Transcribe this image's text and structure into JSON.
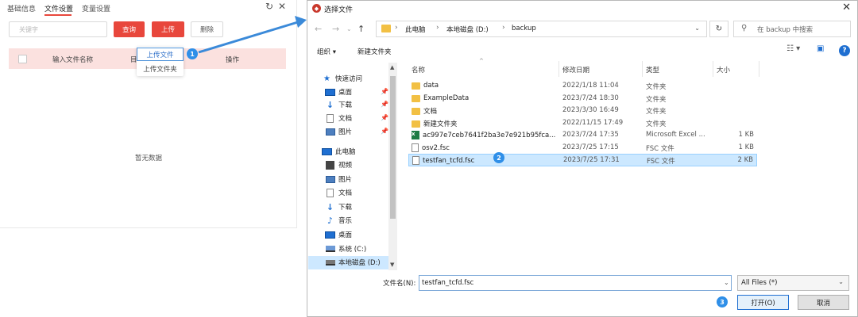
{
  "left_panel": {
    "tabs": [
      "基础信息",
      "文件设置",
      "变量设置"
    ],
    "active_tab": 1,
    "search_placeholder": "关键字",
    "buttons": {
      "query": "查询",
      "upload": "上传",
      "delete": "删除"
    },
    "table_headers": {
      "name": "输入文件名称",
      "col2": "目",
      "ops": "操作"
    },
    "empty_text": "暂无数据",
    "upload_menu": [
      "上传文件",
      "上传文件夹"
    ],
    "accent_color": "#e8473c"
  },
  "badges": [
    "1",
    "2",
    "3"
  ],
  "dialog": {
    "title": "选择文件",
    "address": [
      "此电脑",
      "本地磁盘 (D:)",
      "backup"
    ],
    "search_placeholder": "在 backup 中搜索",
    "toolbar": {
      "organize": "组织 ▾",
      "new_folder": "新建文件夹"
    },
    "nav": [
      {
        "label": "快速访问",
        "icon": "star-icon",
        "level": 1
      },
      {
        "label": "桌面",
        "icon": "desktop-icon",
        "level": 2,
        "pinned": true
      },
      {
        "label": "下载",
        "icon": "download-icon",
        "level": 2,
        "pinned": true
      },
      {
        "label": "文档",
        "icon": "document-icon",
        "level": 2,
        "pinned": true
      },
      {
        "label": "图片",
        "icon": "picture-icon",
        "level": 2,
        "pinned": true
      },
      {
        "label": "此电脑",
        "icon": "computer-icon",
        "level": 1
      },
      {
        "label": "视频",
        "icon": "video-icon",
        "level": 2
      },
      {
        "label": "图片",
        "icon": "picture-icon",
        "level": 2
      },
      {
        "label": "文档",
        "icon": "document-icon",
        "level": 2
      },
      {
        "label": "下载",
        "icon": "download-icon",
        "level": 2
      },
      {
        "label": "音乐",
        "icon": "music-icon",
        "level": 2
      },
      {
        "label": "桌面",
        "icon": "desktop-icon",
        "level": 2
      },
      {
        "label": "系统 (C:)",
        "icon": "drive-c-icon",
        "level": 2
      },
      {
        "label": "本地磁盘 (D:)",
        "icon": "drive-icon",
        "level": 2,
        "selected": true
      }
    ],
    "columns": [
      "名称",
      "修改日期",
      "类型",
      "大小"
    ],
    "files": [
      {
        "name": "data",
        "date": "2022/1/18 11:04",
        "type": "文件夹",
        "size": "",
        "icon": "folder-icon"
      },
      {
        "name": "ExampleData",
        "date": "2023/7/24 18:30",
        "type": "文件夹",
        "size": "",
        "icon": "folder-icon"
      },
      {
        "name": "文档",
        "date": "2023/3/30 16:49",
        "type": "文件夹",
        "size": "",
        "icon": "folder-icon"
      },
      {
        "name": "新建文件夹",
        "date": "2022/11/15 17:49",
        "type": "文件夹",
        "size": "",
        "icon": "folder-icon"
      },
      {
        "name": "ac997e7ceb7641f2ba3e7e921b95fca...",
        "date": "2023/7/24 17:35",
        "type": "Microsoft Excel ...",
        "size": "1 KB",
        "icon": "excel-icon"
      },
      {
        "name": "osv2.fsc",
        "date": "2023/7/25 17:15",
        "type": "FSC 文件",
        "size": "1 KB",
        "icon": "file-icon"
      },
      {
        "name": "testfan_tcfd.fsc",
        "date": "2023/7/25 17:31",
        "type": "FSC 文件",
        "size": "2 KB",
        "icon": "file-icon",
        "selected": true
      }
    ],
    "filename_label": "文件名(N):",
    "filename_value": "testfan_tcfd.fsc",
    "filetype": "All Files (*)",
    "open_button": "打开(O)",
    "cancel_button": "取消"
  }
}
